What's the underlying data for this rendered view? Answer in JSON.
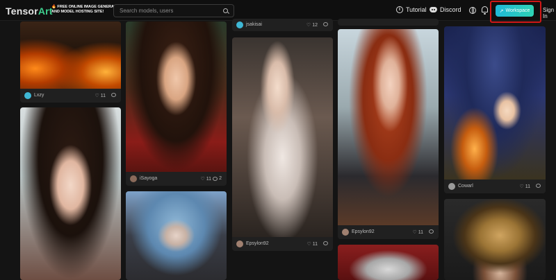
{
  "header": {
    "logo_prefix": "Tensor",
    "logo_suffix": "Art",
    "promo_line1": "FREE ONLINE IMAGE GENERATOR",
    "promo_line2": "AND MODEL HOSTING SITE!",
    "search_placeholder": "Search models, users",
    "tutorial_label": "Tutorial",
    "discord_label": "Discord",
    "workspace_label": "Workspace",
    "signin_label": "Sign In"
  },
  "columns": [
    {
      "cards": [
        {
          "user": "Lxzy",
          "likes": "11",
          "comments": "",
          "avatar_color": "#3fb8d6"
        },
        {
          "user": "",
          "likes": "",
          "comments": "",
          "avatar_color": "#777777"
        }
      ]
    },
    {
      "cards": [
        {
          "user": "iSayoga",
          "likes": "11",
          "comments": "2",
          "avatar_color": "#8a6a5a"
        },
        {
          "user": "",
          "likes": "",
          "comments": "",
          "avatar_color": "#777777"
        }
      ]
    },
    {
      "cards": [
        {
          "user": "jsakisai",
          "likes": "12",
          "comments": "",
          "avatar_color": "#3fb8d6"
        },
        {
          "user": "Epsylon92",
          "likes": "11",
          "comments": "",
          "avatar_color": "#a08070"
        }
      ]
    },
    {
      "cards": [
        {
          "user": "",
          "likes": "",
          "comments": "",
          "avatar_color": "#777777"
        },
        {
          "user": "Epsylon92",
          "likes": "11",
          "comments": "",
          "avatar_color": "#a08070"
        },
        {
          "user": "",
          "likes": "",
          "comments": "",
          "avatar_color": "#777777"
        }
      ]
    },
    {
      "cards": [
        {
          "user": "Cowarl",
          "likes": "11",
          "comments": "",
          "avatar_color": "#9a9a9a"
        },
        {
          "user": "",
          "likes": "",
          "comments": "",
          "avatar_color": "#777777"
        }
      ]
    }
  ],
  "colors": {
    "accent_start": "#1fb8d8",
    "accent_end": "#2ed3b4",
    "highlight_box": "#d11717",
    "logo_accent": "#3ecf8e"
  },
  "icons": {
    "tutorial": "info-icon",
    "discord": "discord-icon",
    "language": "globe-icon",
    "notifications": "bell-icon",
    "workspace": "sparkle-icon",
    "search": "search-icon"
  }
}
